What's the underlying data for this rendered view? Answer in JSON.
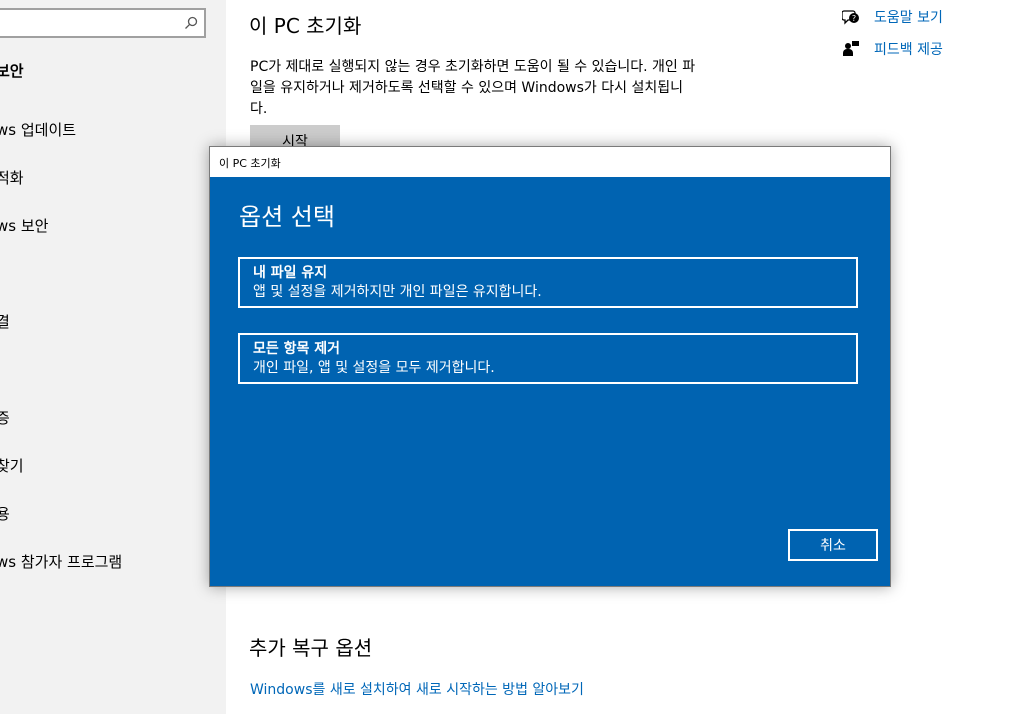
{
  "sidebar": {
    "search_placeholder": "",
    "heading": "보안",
    "items": [
      "ws 업데이트",
      "적화",
      "ws 보안",
      "결",
      "증",
      "찾기",
      "용",
      "ws 참가자 프로그램"
    ]
  },
  "main": {
    "title": "이 PC 초기화",
    "description": "PC가 제대로 실행되지 않는 경우 초기화하면 도움이 될 수 있습니다. 개인 파일을 유지하거나 제거하도록 선택할 수 있으며 Windows가 다시 설치됩니다.",
    "start_label": "시작",
    "recovery_title": "추가 복구 옵션",
    "recovery_link": "Windows를 새로 설치하여 새로 시작하는 방법 알아보기"
  },
  "related": {
    "help_label": "도움말 보기",
    "feedback_label": "피드백 제공"
  },
  "dialog": {
    "window_title": "이 PC 초기화",
    "heading": "옵션 선택",
    "options": [
      {
        "title": "내 파일 유지",
        "desc": "앱 및 설정을 제거하지만 개인 파일은 유지합니다."
      },
      {
        "title": "모든 항목 제거",
        "desc": "개인 파일, 앱 및 설정을 모두 제거합니다."
      }
    ],
    "cancel_label": "취소"
  },
  "colors": {
    "dialog_blue": "#0063b1",
    "link_blue": "#0067b8",
    "sidebar_bg": "#f2f2f2"
  }
}
